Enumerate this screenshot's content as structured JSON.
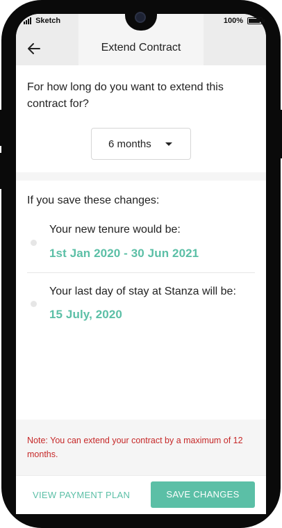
{
  "status_bar": {
    "carrier": "Sketch",
    "time": "",
    "battery": "100%",
    "battery_level": 1.0
  },
  "header": {
    "title": "Extend Contract",
    "back_icon": "arrow-left-icon"
  },
  "extend": {
    "question": "For how long do you want to extend this contract for?",
    "duration_selected": "6 months"
  },
  "changes": {
    "intro": "If you save these changes:",
    "items": [
      {
        "label": "Your new tenure would be:",
        "value": "1st Jan 2020 - 30 Jun 2021"
      },
      {
        "label": "Your last day of stay at Stanza will be:",
        "value": "15 July, 2020"
      }
    ]
  },
  "note": "Note: You can extend your contract by a maximum of 12 months.",
  "actions": {
    "secondary_label": "VIEW PAYMENT PLAN",
    "primary_label": "SAVE CHANGES"
  },
  "colors": {
    "accent": "#5bbfa6",
    "note": "#c62828",
    "background": "#f5f5f5",
    "frame": "#0a0a0a"
  }
}
